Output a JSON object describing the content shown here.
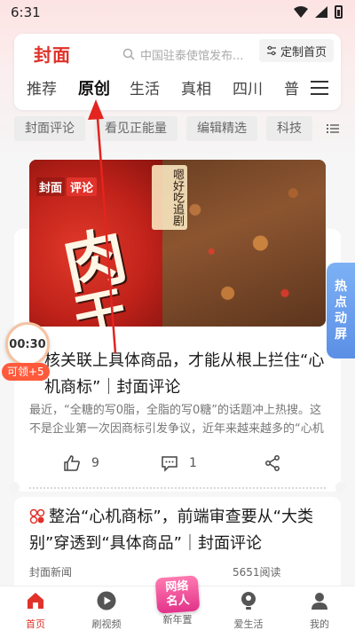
{
  "status_bar": {
    "time": "6:31"
  },
  "header": {
    "logo": "封面",
    "search_placeholder": "中国驻泰使馆发布...",
    "custom_home_label": "定制首页",
    "tabs": [
      "推荐",
      "原创",
      "生活",
      "真相",
      "四川",
      "普"
    ],
    "active_tab": "原创"
  },
  "subtags": [
    "封面评论",
    "看见正能量",
    "编辑精选",
    "科技"
  ],
  "article": {
    "image_watermark_a": "封面",
    "image_watermark_b": "评论",
    "image_slogan": "嗯好吃追剧",
    "image_text_1": "肉",
    "image_text_2": "干",
    "title": "核关联上具体商品，才能从根上拦住“心机商标”｜封面评论",
    "summary": "最近，“全糖的写0脂，全脂的写0糖”的话题冲上热搜。这不是企业第一次因商标引发争议，近年来越来越多的“心机商标”被曝光···",
    "likes": "9",
    "comments": "1"
  },
  "article2": {
    "title": "整治“心机商标”，前端审查要从“大类别”穿透到“具体商品”｜封面评论",
    "source": "封面新闻",
    "reads": "5651阅读"
  },
  "widgets": {
    "timer": "00:30",
    "timer_badge": "可领+5",
    "hot_tab": [
      "热",
      "点",
      "动",
      "屏"
    ]
  },
  "bottom_nav": {
    "items": [
      "首页",
      "刷视频",
      "",
      "爱生活",
      "我的"
    ],
    "center_badge_line1": "网络",
    "center_badge_line2": "名人",
    "center_label": "新年置"
  },
  "colors": {
    "accent": "#e0322b",
    "hot_tab": "#6a9ff0",
    "timer_badge": "#ff5a3c"
  }
}
